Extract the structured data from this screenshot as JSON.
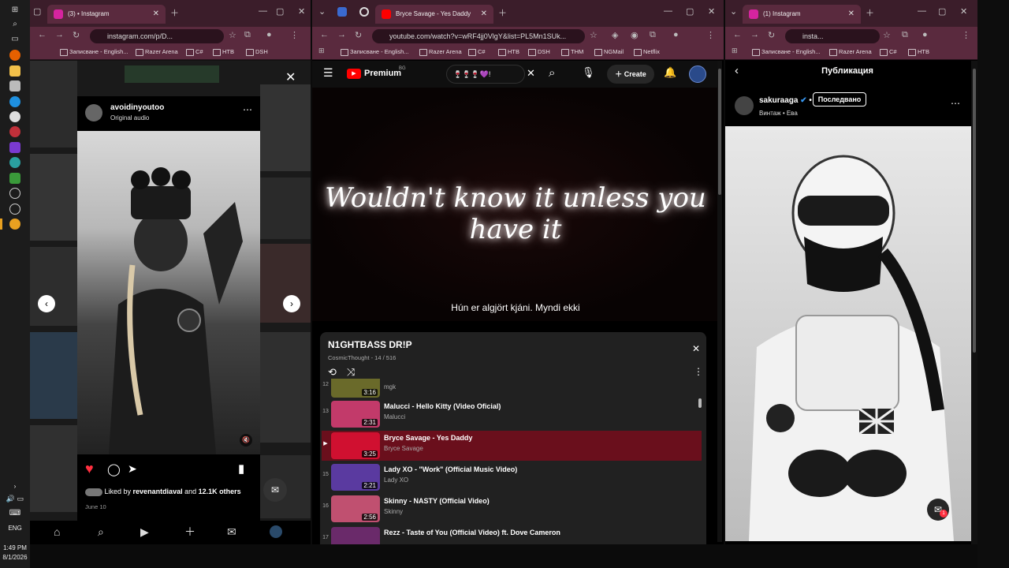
{
  "taskbar": {
    "time": "1:49 PM",
    "date": "8/1/2026",
    "language": "ENG"
  },
  "left_window": {
    "tab_title": "(3) • Instagram",
    "url": "instagram.com/p/D...",
    "bookmarks": [
      "Записване - English...",
      "Razer Arena",
      "C#",
      "HTB",
      "DSH"
    ],
    "post": {
      "username": "avoidinyoutoo",
      "audio": "Original audio",
      "liked_by_prefix": "Liked by ",
      "liked_by_user": "revenantdiaval",
      "liked_by_mid": " and ",
      "liked_by_count": "12.1K others",
      "date": "June 10"
    }
  },
  "middle_window": {
    "tab_title": "Bryce Savage - Yes Daddy",
    "url": "youtube.com/watch?v=wRF4jj0VlgY&list=PL5Mn1SUk...",
    "bookmarks": [
      "Записване - English...",
      "Razer Arena",
      "C#",
      "HTB",
      "DSH",
      "THM",
      "NGMail",
      "Netflix"
    ],
    "brand": "Premium",
    "brand_sup": "BG",
    "search_value": "🍷🍷🍷💜!",
    "create_label": "Create",
    "notification_badge": "",
    "video": {
      "lyric": "Wouldn't know it unless you have it",
      "caption": "Hún er algjört kjáni.  Myndi ekki"
    },
    "playlist": {
      "title": "N1GHTBASS DR!P",
      "meta": "CosmicThought - 14 / 516",
      "items": [
        {
          "index": "12",
          "title": "",
          "channel": "mgk",
          "duration": "3:16",
          "color": "#6a6a2a"
        },
        {
          "index": "13",
          "title": "Malucci - Hello Kitty (Video Oficial)",
          "channel": "Malucci",
          "duration": "2:31",
          "color": "#c23a6a"
        },
        {
          "index": "▶",
          "title": "Bryce Savage - Yes Daddy",
          "channel": "Bryce Savage",
          "duration": "3:25",
          "color": "#d01030"
        },
        {
          "index": "15",
          "title": "Lady XO - \"Work\" (Official Music Video)",
          "channel": "Lady XO",
          "duration": "2:21",
          "color": "#5a3aa0"
        },
        {
          "index": "16",
          "title": "Skinny - NASTY (Official Video)",
          "channel": "Skinny",
          "duration": "2:56",
          "color": "#c05070"
        },
        {
          "index": "17",
          "title": "Rezz - Taste of You (Official Video) ft. Dove Cameron",
          "channel": "",
          "duration": "",
          "color": "#6a2a6a"
        }
      ]
    }
  },
  "right_window": {
    "tab_title": "(1) Instagram",
    "url": "insta...",
    "bookmarks": [
      "Записване - English...",
      "Razer Arena",
      "C#",
      "HTB"
    ],
    "header_title": "Публикация",
    "username": "sakuraaga",
    "follow_label": "Последвано",
    "subtitle": "Винтаж • Ева",
    "notification_count": "1"
  },
  "colors": {
    "tab_bar": "#3b1d2a",
    "toolbar": "#5a2a3e",
    "playlist_active": "#6a0f1c",
    "yt_red": "#ff0000",
    "like_red": "#ff3040"
  }
}
